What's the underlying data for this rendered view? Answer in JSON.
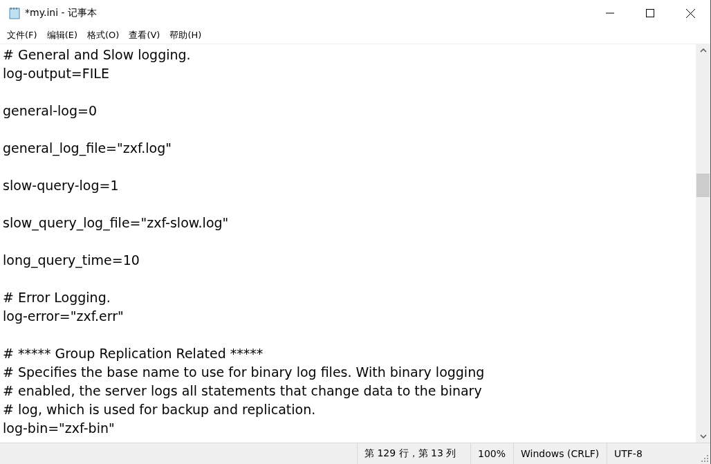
{
  "window": {
    "title": "*my.ini - 记事本"
  },
  "menu": [
    "文件(F)",
    "编辑(E)",
    "格式(O)",
    "查看(V)",
    "帮助(H)"
  ],
  "editor": {
    "paragraphs": [
      [
        "# General and Slow logging.",
        "log-output=FILE"
      ],
      [
        "general-log=0"
      ],
      [
        "general_log_file=\"zxf.log\""
      ],
      [
        "slow-query-log=1"
      ],
      [
        "slow_query_log_file=\"zxf-slow.log\""
      ],
      [
        "long_query_time=10"
      ],
      [
        "# Error Logging.",
        "log-error=\"zxf.err\""
      ],
      [
        "# ***** Group Replication Related *****",
        "# Specifies the base name to use for binary log files. With binary logging",
        "# enabled, the server logs all statements that change data to the binary",
        "# log, which is used for backup and replication.",
        "log-bin=\"zxf-bin\""
      ]
    ]
  },
  "status_bar": [
    "第 129 行，第 13 列",
    "100%",
    "Windows (CRLF)",
    "UTF-8"
  ]
}
